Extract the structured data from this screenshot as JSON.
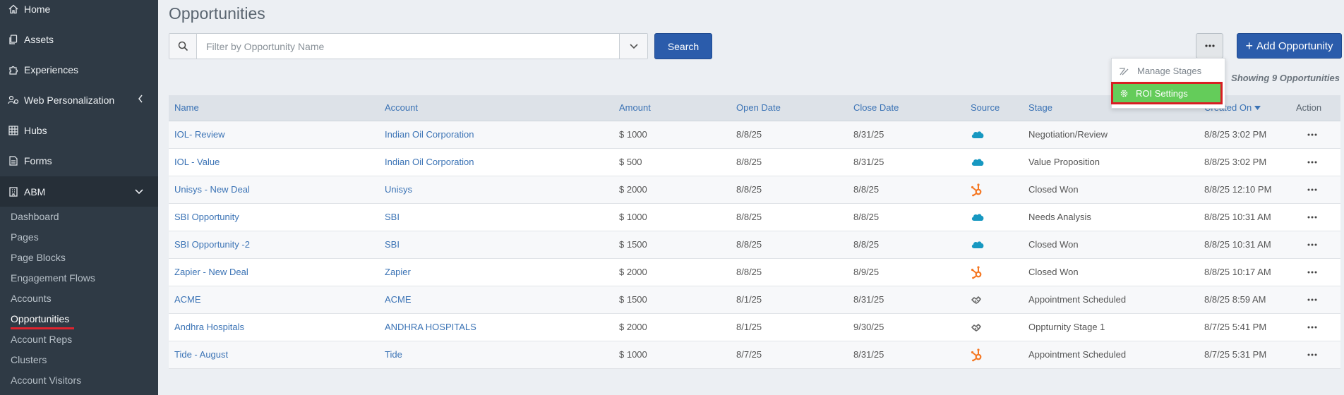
{
  "sidebar": {
    "items": [
      {
        "label": "Home",
        "icon": "home-icon"
      },
      {
        "label": "Assets",
        "icon": "copy-icon"
      },
      {
        "label": "Experiences",
        "icon": "puzzle-icon"
      },
      {
        "label": "Web Personalization",
        "icon": "users-cog-icon"
      },
      {
        "label": "Hubs",
        "icon": "grid-icon"
      },
      {
        "label": "Forms",
        "icon": "file-icon"
      },
      {
        "label": "ABM",
        "icon": "building-icon"
      }
    ],
    "abm_subitems": [
      "Dashboard",
      "Pages",
      "Page Blocks",
      "Engagement Flows",
      "Accounts",
      "Opportunities",
      "Account Reps",
      "Clusters",
      "Account Visitors"
    ],
    "selected_subitem": "Opportunities"
  },
  "page": {
    "title": "Opportunities",
    "filter_placeholder": "Filter by Opportunity Name",
    "search_label": "Search",
    "more_label": "···",
    "add_label": "Add Opportunity",
    "showing": "Showing 9 Opportunities"
  },
  "menu": {
    "manage_stages": "Manage Stages",
    "roi_settings": "ROI Settings"
  },
  "colors": {
    "accent": "#2b5cab",
    "link": "#3b73b5",
    "highlight_green": "#64cc5a",
    "highlight_border": "#d81e23",
    "salesforce": "#1798c1",
    "hubspot": "#f57722"
  },
  "table": {
    "headers": {
      "name": "Name",
      "account": "Account",
      "amount": "Amount",
      "open_date": "Open Date",
      "close_date": "Close Date",
      "source": "Source",
      "stage": "Stage",
      "created_on": "Created On",
      "action": "Action"
    },
    "sort_column": "Created On",
    "sort_direction": "descending",
    "rows": [
      {
        "name": "IOL- Review",
        "account": "Indian Oil Corporation",
        "amount": "$ 1000",
        "open_date": "8/8/25",
        "close_date": "8/31/25",
        "source": "salesforce",
        "stage": "Negotiation/Review",
        "created_on": "8/8/25 3:02 PM"
      },
      {
        "name": "IOL - Value",
        "account": "Indian Oil Corporation",
        "amount": "$ 500",
        "open_date": "8/8/25",
        "close_date": "8/31/25",
        "source": "salesforce",
        "stage": "Value Proposition",
        "created_on": "8/8/25 3:02 PM"
      },
      {
        "name": "Unisys - New Deal",
        "account": "Unisys",
        "amount": "$ 2000",
        "open_date": "8/8/25",
        "close_date": "8/8/25",
        "source": "hubspot",
        "stage": "Closed Won",
        "created_on": "8/8/25 12:10 PM"
      },
      {
        "name": "SBI Opportunity",
        "account": "SBI",
        "amount": "$ 1000",
        "open_date": "8/8/25",
        "close_date": "8/8/25",
        "source": "salesforce",
        "stage": "Needs Analysis",
        "created_on": "8/8/25 10:31 AM"
      },
      {
        "name": "SBI Opportunity -2",
        "account": "SBI",
        "amount": "$ 1500",
        "open_date": "8/8/25",
        "close_date": "8/8/25",
        "source": "salesforce",
        "stage": "Closed Won",
        "created_on": "8/8/25 10:31 AM"
      },
      {
        "name": "Zapier - New Deal",
        "account": "Zapier",
        "amount": "$ 2000",
        "open_date": "8/8/25",
        "close_date": "8/9/25",
        "source": "hubspot",
        "stage": "Closed Won",
        "created_on": "8/8/25 10:17 AM"
      },
      {
        "name": "ACME",
        "account": "ACME",
        "amount": "$ 1500",
        "open_date": "8/1/25",
        "close_date": "8/31/25",
        "source": "manual",
        "stage": "Appointment Scheduled",
        "created_on": "8/8/25 8:59 AM"
      },
      {
        "name": "Andhra Hospitals",
        "account": "ANDHRA HOSPITALS",
        "amount": "$ 2000",
        "open_date": "8/1/25",
        "close_date": "9/30/25",
        "source": "manual",
        "stage": "Oppturnity Stage 1",
        "created_on": "8/7/25 5:41 PM"
      },
      {
        "name": "Tide - August",
        "account": "Tide",
        "amount": "$ 1000",
        "open_date": "8/7/25",
        "close_date": "8/31/25",
        "source": "hubspot",
        "stage": "Appointment Scheduled",
        "created_on": "8/7/25 5:31 PM"
      }
    ]
  }
}
